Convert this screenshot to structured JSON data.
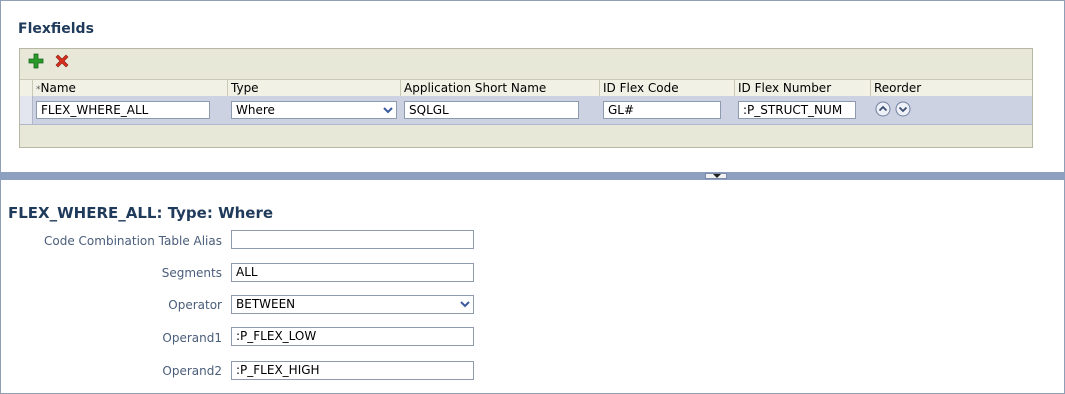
{
  "section_title": "Flexfields",
  "toolbar": {
    "add_icon": "plus-icon",
    "delete_icon": "x-icon"
  },
  "table": {
    "headers": {
      "name": "Name",
      "required_mark": "*",
      "type": "Type",
      "app_short_name": "Application Short Name",
      "id_flex_code": "ID Flex Code",
      "id_flex_number": "ID Flex Number",
      "reorder": "Reorder"
    },
    "rows": [
      {
        "name": "FLEX_WHERE_ALL",
        "type": "Where",
        "app_short_name": "SQLGL",
        "id_flex_code": "GL#",
        "id_flex_number": ":P_STRUCT_NUM"
      }
    ]
  },
  "detail": {
    "title": "FLEX_WHERE_ALL: Type: Where",
    "fields": {
      "alias_label": "Code Combination Table Alias",
      "alias_value": "",
      "segments_label": "Segments",
      "segments_value": "ALL",
      "operator_label": "Operator",
      "operator_value": "BETWEEN",
      "operand1_label": "Operand1",
      "operand1_value": ":P_FLEX_LOW",
      "operand2_label": "Operand2",
      "operand2_value": ":P_FLEX_HIGH"
    }
  },
  "colors": {
    "title": "#1f3a5a",
    "label": "#4a5d7a",
    "selected_row": "#ccd2e2",
    "divider": "#8ea0c0",
    "add_icon": "#2a9a2a",
    "delete_icon": "#d83020"
  }
}
